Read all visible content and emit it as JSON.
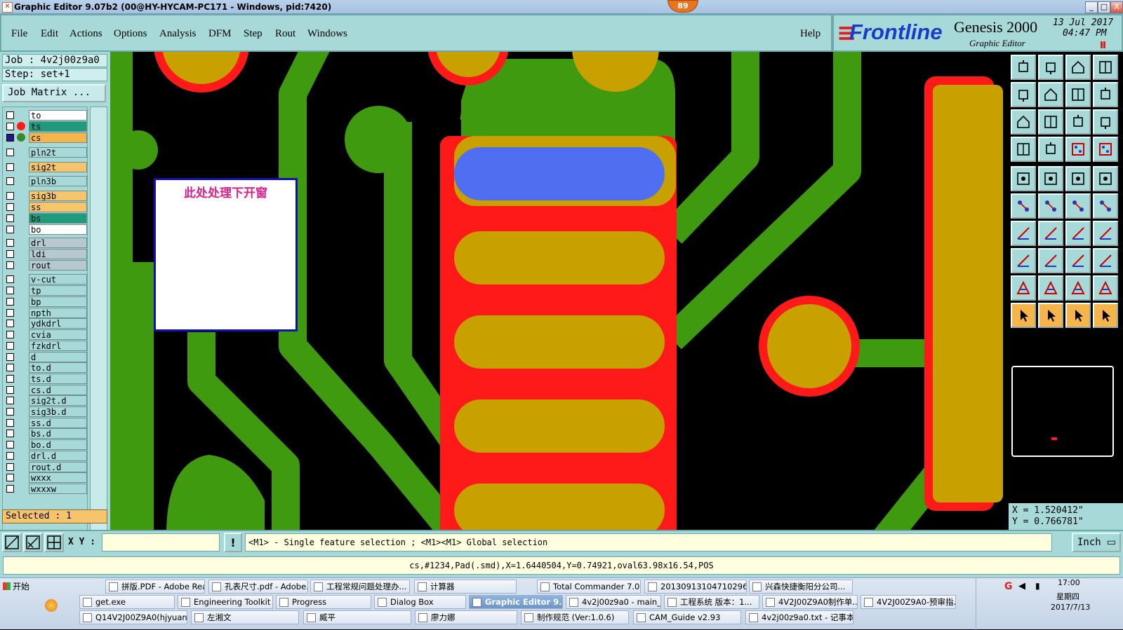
{
  "window": {
    "title": "Graphic Editor 9.07b2 (00@HY-HYCAM-PC171 - Windows, pid:7420)",
    "badge": "89",
    "min_btn": "_",
    "max_btn": "□",
    "close_btn": "X"
  },
  "menu": [
    "File",
    "Edit",
    "Actions",
    "Options",
    "Analysis",
    "DFM",
    "Step",
    "Rout",
    "Windows"
  ],
  "help": "Help",
  "logo": {
    "brand": "Frontline",
    "product": "Genesis 2000",
    "subtitle": "Graphic Editor",
    "date": "13 Jul 2017",
    "time": "04:47 PM"
  },
  "job": {
    "job_label": "Job : 4v2j00z9a0",
    "step_label": "Step: set+1",
    "matrix_button": "Job Matrix ..."
  },
  "layers": [
    {
      "name": "to",
      "color": "#ffffff"
    },
    {
      "name": "ts",
      "color": "#1f9a7a"
    },
    {
      "name": "cs",
      "color": "#f6b54a"
    },
    {
      "name": "pln2t",
      "color": "#a7d9d9"
    },
    {
      "name": "sig2t",
      "color": "#f6c46b"
    },
    {
      "name": "pln3b",
      "color": "#a7d9d9"
    },
    {
      "name": "sig3b",
      "color": "#f6c46b"
    },
    {
      "name": "ss",
      "color": "#f6c46b"
    },
    {
      "name": "bs",
      "color": "#1f9a7a"
    },
    {
      "name": "bo",
      "color": "#ffffff"
    },
    {
      "name": "drl",
      "color": "#b8c8d0"
    },
    {
      "name": "ldi",
      "color": "#b8c8d0"
    },
    {
      "name": "rout",
      "color": "#b8c8d0"
    },
    {
      "name": "v-cut",
      "color": "#a7d9d9"
    },
    {
      "name": "tp",
      "color": "#a7d9d9"
    },
    {
      "name": "bp",
      "color": "#a7d9d9"
    },
    {
      "name": "npth",
      "color": "#a7d9d9"
    },
    {
      "name": "ydkdrl",
      "color": "#a7d9d9"
    },
    {
      "name": "cvia",
      "color": "#a7d9d9"
    },
    {
      "name": "fzkdrl",
      "color": "#a7d9d9"
    },
    {
      "name": "d",
      "color": "#a7d9d9"
    },
    {
      "name": "to.d",
      "color": "#a7d9d9"
    },
    {
      "name": "ts.d",
      "color": "#a7d9d9"
    },
    {
      "name": "cs.d",
      "color": "#a7d9d9"
    },
    {
      "name": "sig2t.d",
      "color": "#a7d9d9"
    },
    {
      "name": "sig3b.d",
      "color": "#a7d9d9"
    },
    {
      "name": "ss.d",
      "color": "#a7d9d9"
    },
    {
      "name": "bs.d",
      "color": "#a7d9d9"
    },
    {
      "name": "bo.d",
      "color": "#a7d9d9"
    },
    {
      "name": "drl.d",
      "color": "#a7d9d9"
    },
    {
      "name": "rout.d",
      "color": "#a7d9d9"
    },
    {
      "name": "wxxx",
      "color": "#a7d9d9"
    },
    {
      "name": "wxxxw",
      "color": "#a7d9d9"
    }
  ],
  "selected": "Selected : 1",
  "note": "此处处理下开窗",
  "coords": {
    "x": "X = 1.520412\"",
    "y": "Y = 0.766781\""
  },
  "cmd": {
    "xy_label": "X Y :",
    "xy_value": "",
    "message": "<M1> - Single feature selection ; <M1><M1> Global selection",
    "units": "Inch"
  },
  "status": "cs,#1234,Pad(.smd),X=1.6440504,Y=0.74921,oval63.98x16.54,POS",
  "colors": {
    "green": "#3f9a10",
    "red": "#ff1a1a",
    "gold": "#c8a000",
    "blue": "#4f6ff0",
    "panel": "#a7d9d9"
  },
  "taskbar": {
    "start": "开始",
    "row1": [
      "拼版.PDF - Adobe Rea...",
      "孔表尺寸.pdf - Adobe...",
      "工程常规问题处理办...",
      "计算器",
      "Total Commander 7.0 ...",
      "20130913104710296....",
      "兴森快捷衡阳分公司..."
    ],
    "row2": [
      "get.exe",
      "Engineering Toolkit 9...",
      "Progress",
      "Dialog Box",
      "Graphic Editor 9.0...",
      "4v2j00z9a0 - main_qa",
      "工程系统  版本：1...",
      "4V2J00Z9A0制作单...",
      "4V2J00Z9A0-预审指..."
    ],
    "row3": [
      "Q14V2J00Z9A0(hjyuan)...",
      "左湘文",
      "臧平",
      "廖力娜",
      "制作规范 (Ver:1.0.6)",
      "CAM_Guide v2.93",
      "4v2j00z9a0.txt - 记事本"
    ],
    "clock_time": "17:00",
    "clock_day": "星期四",
    "clock_date": "2017/7/13"
  }
}
